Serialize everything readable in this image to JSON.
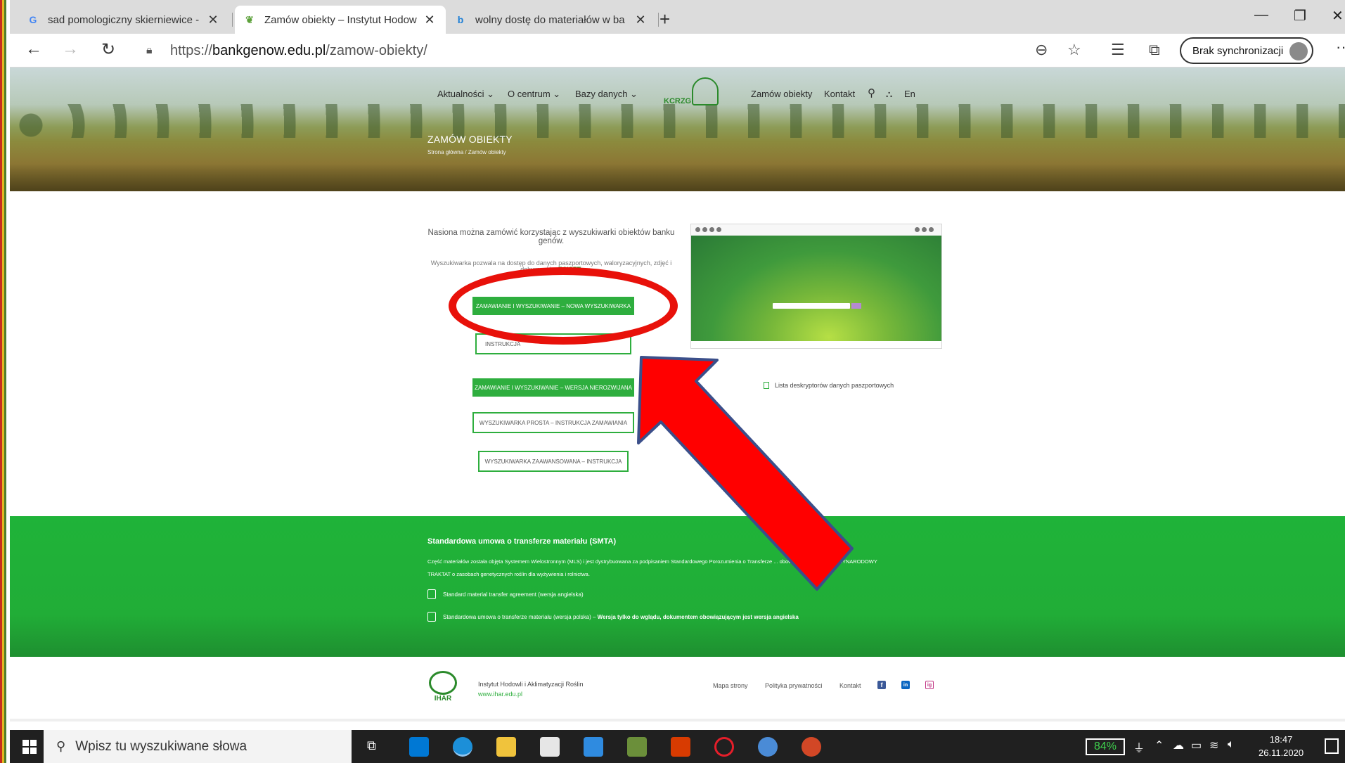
{
  "browser": {
    "tabs": [
      {
        "title": "sad pomologiczny skierniewice - ",
        "favicon": "google-icon"
      },
      {
        "title": "Zamów obiekty – Instytut Hodow",
        "favicon": "ihar-leaf-icon"
      },
      {
        "title": "wolny dostę do materiałów w ba",
        "favicon": "bing-icon"
      }
    ],
    "url_prefix": "https://",
    "url_host": "bankgenow.edu.pl",
    "url_path": "/zamow-obiekty/",
    "sync_label": "Brak synchronizacji"
  },
  "site": {
    "nav": [
      "Aktualności",
      "O centrum",
      "Bazy danych",
      "Zamów obiekty",
      "Kontakt",
      "En"
    ],
    "logo_text": "KCRZG",
    "page_title": "ZAMÓW OBIEKTY",
    "breadcrumb": "Strona główna  /  Zamów obiekty"
  },
  "content": {
    "intro": "Nasiona można zamówić korzystając z wyszukiwarki obiektów banku genów.",
    "intro_small": "Wyszukiwarka pozwala na dostęp do danych paszportowych, waloryzacyjnych, zdjęć i dokumentów",
    "intro_small_bold": "ECISET.",
    "btn_new": "ZAMAWIANIE I WYSZUKIWANIE – NOWA WYSZUKIWARKA",
    "btn_instr": "INSTRUKCJA",
    "btn_old": "ZAMAWIANIE I WYSZUKIWANIE – WERSJA NIEROZWIJANA",
    "btn_simple": "WYSZUKIWARKA PROSTA – INSTRUKCJA ZAMAWIANIA",
    "btn_adv": "WYSZUKIWARKA ZAAWANSOWANA – INSTRUKCJA",
    "desc_link": "Lista deskryptorów danych paszportowych"
  },
  "smta": {
    "title": "Standardowa umowa o transferze materiału (SMTA)",
    "text": "Część materiałów została objęta Systemem Wielostronnym (MLS) i jest dystrybuowana za podpisaniem Standardowego Porozumienia o Transferze ... obowiązek nakłada MIĘDZYNARODOWY TRAKTAT o zasobach genetycznych roślin dla wyżywienia i rolnictwa.",
    "link_en": "Standard material transfer agreement (wersja angielska)",
    "link_pl": "Standardowa umowa o transferze materiału (wersja polska) – ",
    "link_pl_bold": "Wersja tylko do wglądu, dokumentem obowiązującym jest wersja angielska"
  },
  "footer": {
    "logo_text": "IHAR",
    "institute": "Instytut Hodowli i Aklimatyzacji Roślin",
    "url": "www.ihar.edu.pl",
    "links": [
      "Mapa strony",
      "Polityka prywatności",
      "Kontakt"
    ],
    "social": [
      "f",
      "in",
      "ig"
    ]
  },
  "taskbar": {
    "search_placeholder": "Wpisz tu wyszukiwane słowa",
    "battery": "84%",
    "time": "18:47",
    "date": "26.11.2020"
  },
  "annotations": {
    "ellipse_color": "#e8110a",
    "arrow_color": "#ff0000"
  }
}
